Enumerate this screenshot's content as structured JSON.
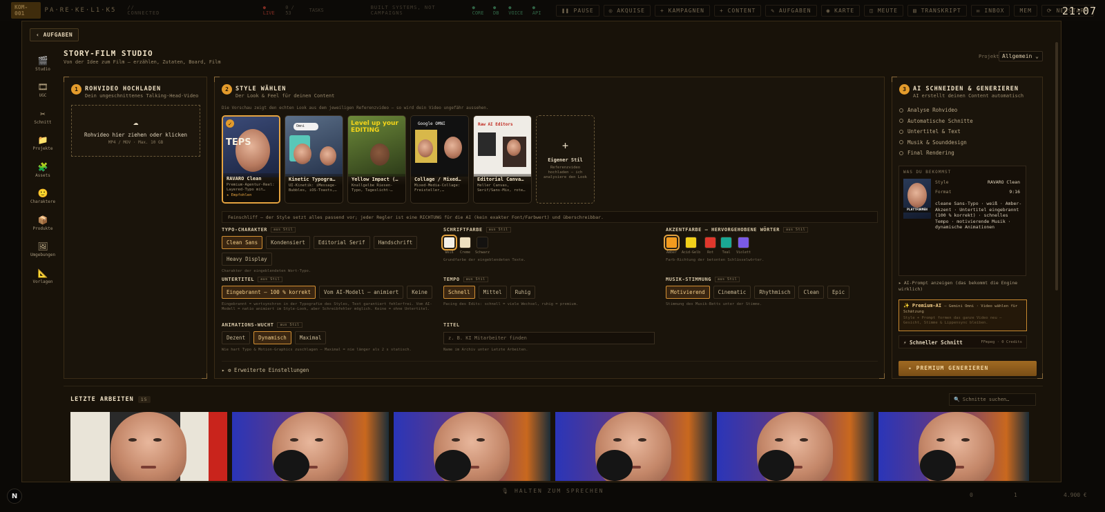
{
  "topbar": {
    "badge": "KOM-001",
    "brand": "PA·RE·KE·L1·K5",
    "connected": "// CONNECTED",
    "live": "● LIVE",
    "ratio": "0 / 53",
    "ratio_suffix": "TASKS",
    "mid": "BUILT SYSTEMS, NOT CAMPAIGNS",
    "checks": [
      "● CORE",
      "● DB",
      "● VOICE",
      "● API"
    ],
    "buttons": [
      "❚❚ PAUSE",
      "◎ AKQUISE",
      "+ KAMPAGNEN",
      "+ CONTENT",
      "✎ AUFGABEN",
      "◉ KARTE",
      "◫ MEUTE",
      "▤ TRANSKRIPT",
      "✉ INBOX",
      "MEM",
      "⟳ NEUSTART"
    ],
    "clock": "21:07"
  },
  "back": "‹ AUFGABEN",
  "sidebar": [
    {
      "icon": "🎬",
      "label": "Studio"
    },
    {
      "icon": "🎞",
      "label": "UGC"
    },
    {
      "icon": "✂",
      "label": "Schnitt"
    },
    {
      "icon": "📁",
      "label": "Projekte"
    },
    {
      "icon": "🧩",
      "label": "Assets"
    },
    {
      "icon": "🙂",
      "label": "Charaktere"
    },
    {
      "icon": "📦",
      "label": "Produkte"
    },
    {
      "icon": "🖼",
      "label": "Umgebungen"
    },
    {
      "icon": "📐",
      "label": "Vorlagen"
    }
  ],
  "header": {
    "title": "STORY-FILM STUDIO",
    "subtitle": "Von der Idee zum Film — erzählen, Zutaten, Board, Film",
    "project_label": "Projekt",
    "project_value": "Allgemein ⌄"
  },
  "step1": {
    "num": "1",
    "title": "ROHVIDEO HOCHLADEN",
    "sub": "Dein ungeschnittenes Talking-Head-Video",
    "drop_icon": "☁",
    "drop_text": "Rohvideo hier ziehen oder klicken",
    "drop_sub": "MP4 / MOV · Max. 10 GB"
  },
  "step2": {
    "num": "2",
    "title": "STYLE WÄHLEN",
    "sub": "Der Look & Feel für deinen Content",
    "hint": "Die Vorschau zeigt den echten Look aus dem jeweiligen Referenzvideo — so wird dein Video ungefähr aussehen.",
    "cards": [
      {
        "name": "RAVARO Clean",
        "desc": "Premium-Agentur-Reel: Layered-Typo mit…",
        "extra": "★ Empfohlen",
        "check": "✓"
      },
      {
        "name": "Kinetic Typogra…",
        "desc": "UI-Kinetik: iMessage-Bubbles, iOS-Toasts,…",
        "overlay": "Omni"
      },
      {
        "name": "Yellow Impact (…",
        "desc": "Knallgelbe Riesen-Typo, Tageslicht-…",
        "overlay": "Level up your EDITING"
      },
      {
        "name": "Collage / Mixed…",
        "desc": "Mixed-Media-Collage: Freisteller,…",
        "overlay": "Google OMNI"
      },
      {
        "name": "Editorial Canva…",
        "desc": "Heller Canvas, Serif/Sans-Mix, rote…",
        "overlay": "Raw  AI Editors"
      }
    ],
    "custom": {
      "plus": "+",
      "title": "Eigener Stil",
      "sub": "Referenzvideo hochladen — ich analysiere den Look"
    },
    "fine": "Feinschliff — der Style setzt alles passend vor; jeder Regler ist eine RICHTUNG für die AI (kein exakter Font/Farbwert) und überschreibbar.",
    "typo": {
      "label": "TYPO-CHARAKTER",
      "tag": "aus Stil",
      "options": [
        "Clean Sans",
        "Kondensiert",
        "Editorial Serif",
        "Handschrift",
        "Heavy Display"
      ],
      "help": "Charakter der eingeblendeten Wort-Typo."
    },
    "schrift": {
      "label": "SCHRIFTFARBE",
      "tag": "aus Stil",
      "swatches": [
        {
          "name": "Weiß",
          "color": "#f5f1e8"
        },
        {
          "name": "Creme",
          "color": "#efe0c0"
        },
        {
          "name": "Schwarz",
          "color": "#141210"
        }
      ],
      "help": "Grundfarbe der eingeblendeten Texte."
    },
    "akzent": {
      "label": "AKZENTFARBE — HERVORGEHOBENE WÖRTER",
      "tag": "aus Stil",
      "swatches": [
        {
          "name": "Amber",
          "color": "#f29a1e"
        },
        {
          "name": "Acid-Gelb",
          "color": "#f2d01a"
        },
        {
          "name": "Rot",
          "color": "#e0372c"
        },
        {
          "name": "Teal",
          "color": "#1aa893"
        },
        {
          "name": "Violett",
          "color": "#7a5ae6"
        }
      ],
      "help": "Farb-Richtung der betonten Schlüsselwörter."
    },
    "untertitel": {
      "label": "UNTERTITEL",
      "tag": "aus Stil",
      "options": [
        "Eingebrannt — 100 % korrekt",
        "Vom AI-Modell — animiert",
        "Keine"
      ],
      "help": "Eingebrannt = wortsynchron in der Typografie des Styles, Text garantiert fehlerfrei. Vom AI-Modell = natio animiert im Style-Look, aber Schreibfehler möglich. Keine = ohne Untertitel."
    },
    "tempo": {
      "label": "TEMPO",
      "tag": "aus Stil",
      "options": [
        "Schnell",
        "Mittel",
        "Ruhig"
      ],
      "help": "Pacing des Edits: schnell = viele Wechsel, ruhig = premium."
    },
    "musik": {
      "label": "MUSIK-STIMMUNG",
      "tag": "aus Stil",
      "options": [
        "Motivierend",
        "Cinematic",
        "Rhythmisch",
        "Clean",
        "Epic"
      ],
      "help": "Stimmung des Musik-Betts unter der Stimme."
    },
    "animation": {
      "label": "ANIMATIONS-WUCHT",
      "tag": "aus Stil",
      "options": [
        "Dezent",
        "Dynamisch",
        "Maximal"
      ],
      "help": "Wie hart Typo & Motion-Graphics zuschlagen — Maximal = nie länger als 2 s statisch."
    },
    "titel": {
      "label": "TITEL",
      "placeholder": "z. B. KI Mitarbeiter finden",
      "help": "Name im Archiv unter Letzte Arbeiten."
    },
    "advanced": "▸ ⚙ Erweiterte Einstellungen"
  },
  "step3": {
    "num": "3",
    "title": "AI SCHNEIDEN & GENERIEREN",
    "sub": "AI erstellt deinen Content automatisch",
    "checklist": [
      "Analyse Rohvideo",
      "Automatische Schnitte",
      "Untertitel & Text",
      "Musik & Sounddesign",
      "Final Rendering"
    ],
    "result": {
      "heading": "WAS DU BEKOMMST",
      "style_label": "Style",
      "style_value": "RAVARO Clean",
      "format_label": "Format",
      "format_value": "9:16",
      "desc": "cleane Sans-Typo · weiß · Amber-Akzent · Untertitel eingebrannt (100 % korrekt) · schnelles Tempo · motivierende Musik · dynamische Animationen",
      "thumb_text": "PLATTFORMEN"
    },
    "prompt": "▸ AI-Prompt anzeigen (das bekommt die Engine wirklich)",
    "premium": {
      "title": "✨ Premium-AI",
      "title_suffix": "— Gemini Omni · Video wählen für Schätzung",
      "sub": "Style + Prompt formen das ganze Video neu — Gesicht, Stimme & Lippensync bleiben."
    },
    "fast": {
      "label": "⚡ Schneller Schnitt",
      "cost": "FFmpeg · 0 Credits"
    },
    "generate": "✦ PREMIUM GENERIEREN"
  },
  "recent": {
    "title": "LETZTE ARBEITEN",
    "count": "15",
    "search_placeholder": "🔍 Schnitte suchen…"
  },
  "bottom": {
    "talk": "🎙 HALTEN ZUM SPRECHEN",
    "n": "N",
    "stats": [
      "0",
      "1",
      "4.900 €"
    ]
  }
}
